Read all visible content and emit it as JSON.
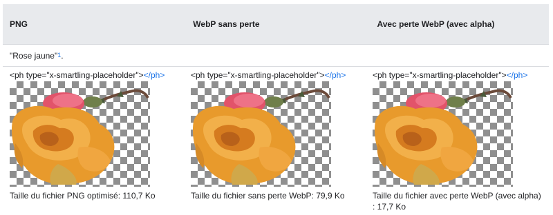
{
  "table": {
    "headers": [
      "PNG",
      "WebP sans perte",
      "Avec perte WebP (avec alpha)"
    ],
    "caption": {
      "text": "\"Rose jaune\" ",
      "footnote": "1",
      "suffix": "."
    },
    "cells": [
      {
        "placeholder_open": "<ph type=\"x-smartling-placeholder\">",
        "placeholder_close": "</ph>",
        "image_alt": "rose-image",
        "size_text": "Taille du fichier PNG optimisé: 110,7 Ko"
      },
      {
        "placeholder_open": "<ph type=\"x-smartling-placeholder\">",
        "placeholder_close": "</ph>",
        "image_alt": "rose-image",
        "size_text": "Taille du fichier sans perte WebP: 79,9 Ko"
      },
      {
        "placeholder_open": "<ph type=\"x-smartling-placeholder\">",
        "placeholder_close": "</ph>",
        "image_alt": "rose-image",
        "size_text": "Taille du fichier avec perte WebP (avec alpha) : 17,7 Ko"
      }
    ]
  },
  "colors": {
    "header_bg": "#e8eaed",
    "link": "#1a73e8",
    "checker": "#8f8f8f"
  }
}
